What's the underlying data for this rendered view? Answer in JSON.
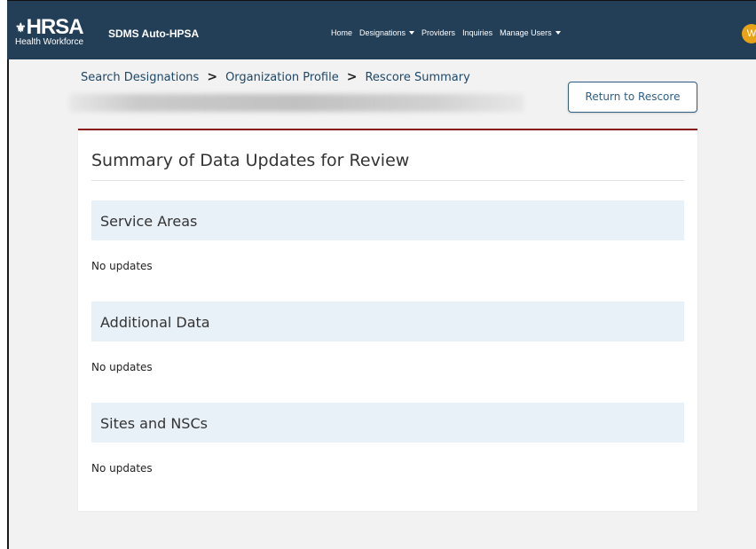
{
  "header": {
    "logo_main": "HRSA",
    "logo_sub": "Health Workforce",
    "app_name": "SDMS Auto-HPSA",
    "nav": [
      {
        "label": "Home",
        "dropdown": false
      },
      {
        "label": "Designations",
        "dropdown": true
      },
      {
        "label": "Providers",
        "dropdown": false
      },
      {
        "label": "Inquiries",
        "dropdown": false
      },
      {
        "label": "Manage Users",
        "dropdown": true
      }
    ],
    "avatar_initial": "W",
    "colors": {
      "navbar": "#233f58",
      "avatar": "#e8a317"
    }
  },
  "breadcrumb": [
    "Search Designations",
    "Organization Profile",
    "Rescore Summary"
  ],
  "return_button_label": "Return to Rescore",
  "card": {
    "title": "Summary of Data Updates for Review",
    "accent_color": "#8b1a1a",
    "sections": [
      {
        "title": "Service Areas",
        "body": "No updates"
      },
      {
        "title": "Additional Data",
        "body": "No updates"
      },
      {
        "title": "Sites and NSCs",
        "body": "No updates"
      }
    ]
  }
}
